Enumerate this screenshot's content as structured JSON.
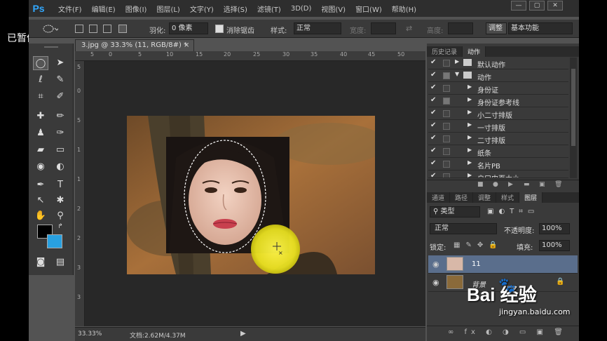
{
  "overlay": {
    "paused_label": "已暂停"
  },
  "app": {
    "logo": "Ps"
  },
  "menu": [
    "文件(F)",
    "编辑(E)",
    "图像(I)",
    "图层(L)",
    "文字(Y)",
    "选择(S)",
    "滤镜(T)",
    "3D(D)",
    "视图(V)",
    "窗口(W)",
    "帮助(H)"
  ],
  "window_controls": {
    "minimize": "—",
    "restore": "▢",
    "close": "✕"
  },
  "options": {
    "feather_label": "羽化:",
    "feather_value": "0 像素",
    "antialias_label": "消除锯齿",
    "style_label": "样式:",
    "style_value": "正常",
    "width_label": "宽度:",
    "height_label": "高度:",
    "refine_label": "调整",
    "workspace_value": "基本功能"
  },
  "document": {
    "tab_title": "3.jpg @ 33.3% (11, RGB/8#) *",
    "tab_close": "×",
    "ruler_top": [
      "5",
      "0",
      "5",
      "10",
      "15",
      "20",
      "25",
      "30",
      "35",
      "40",
      "45",
      "50"
    ],
    "ruler_left": [
      "5",
      "0",
      "5",
      "1",
      "1",
      "2",
      "2",
      "3",
      "3"
    ],
    "zoom": "33.33%",
    "doc_info": "文档:2.62M/4.37M"
  },
  "panels": {
    "top_tabs": [
      "历史记录",
      "动作"
    ],
    "actions": [
      {
        "label": "默认动作",
        "checked": true,
        "folder": true,
        "expanded": false,
        "indent": 0
      },
      {
        "label": "动作",
        "checked": true,
        "folder": true,
        "expanded": true,
        "indent": 0
      },
      {
        "label": "身份证",
        "checked": true,
        "folder": false,
        "expanded": false,
        "indent": 1
      },
      {
        "label": "身份证参考线",
        "checked": true,
        "folder": false,
        "expanded": false,
        "indent": 1
      },
      {
        "label": "小二寸排版",
        "checked": true,
        "folder": false,
        "expanded": false,
        "indent": 1
      },
      {
        "label": "一寸排版",
        "checked": true,
        "folder": false,
        "expanded": false,
        "indent": 1
      },
      {
        "label": "二寸排版",
        "checked": true,
        "folder": false,
        "expanded": false,
        "indent": 1
      },
      {
        "label": "纸条",
        "checked": true,
        "folder": false,
        "expanded": false,
        "indent": 1
      },
      {
        "label": "名片PB",
        "checked": true,
        "folder": false,
        "expanded": false,
        "indent": 1
      },
      {
        "label": "户口内页大小",
        "checked": true,
        "folder": false,
        "expanded": false,
        "indent": 1
      }
    ],
    "layer_tabs": [
      "通道",
      "路径",
      "调整",
      "样式",
      "图层"
    ],
    "filter_value": "类型",
    "blend_mode": "正常",
    "opacity_label": "不透明度:",
    "opacity_value": "100%",
    "lock_label": "锁定:",
    "fill_label": "填充:",
    "fill_value": "100%",
    "layers": [
      {
        "name": "11",
        "selected": true
      },
      {
        "name": "背景",
        "selected": false
      }
    ],
    "bottom_icons": "∞ fx ◐ ◑ ▭ ▣ 🗑"
  },
  "watermark": {
    "brand": "Bai  经验",
    "url": "jingyan.baidu.com"
  }
}
